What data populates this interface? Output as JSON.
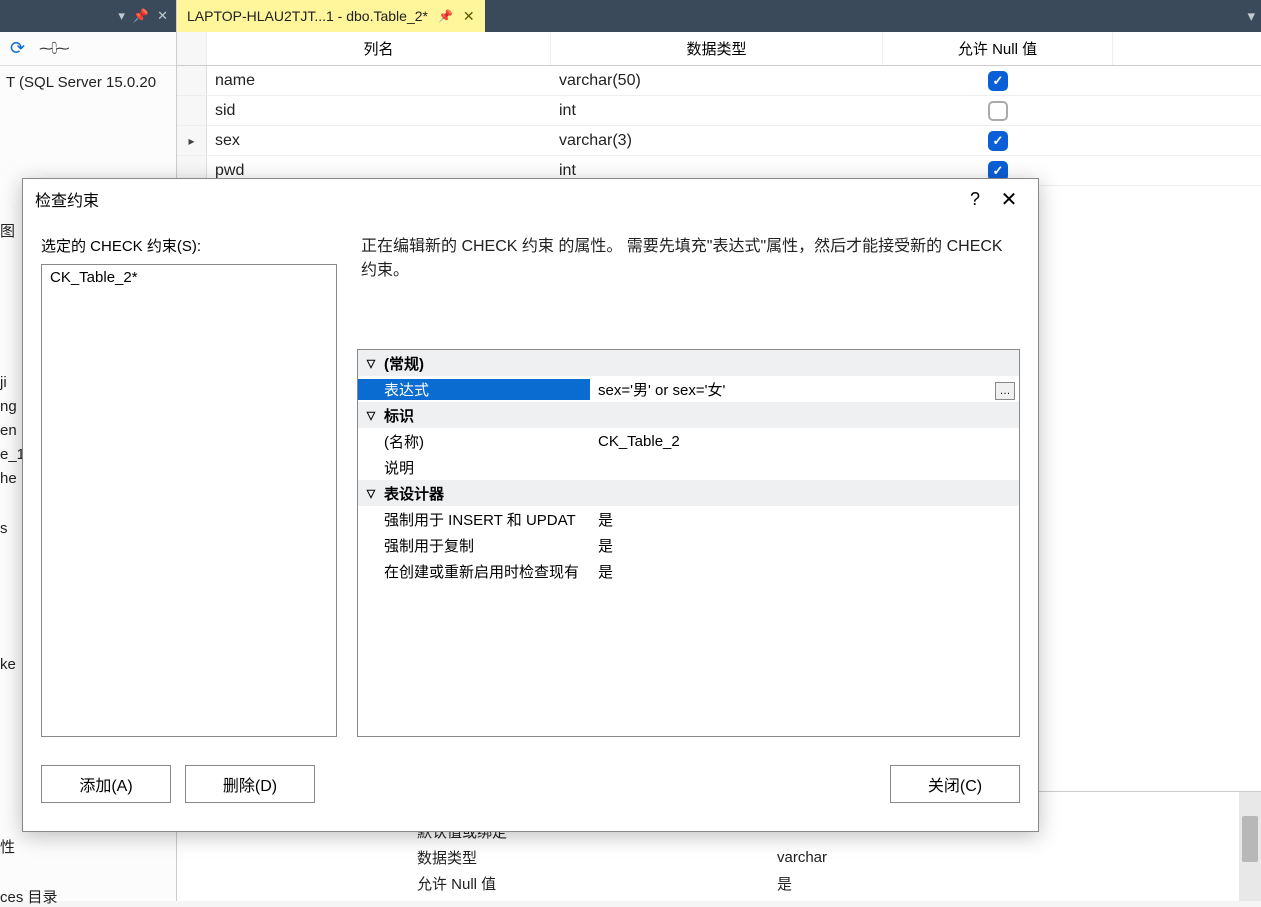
{
  "left_panel": {
    "server_line": "T (SQL Server 15.0.20",
    "fragments": [
      "图",
      "ji",
      "ng",
      "en",
      "e_1",
      "he",
      "s",
      "ces 目录",
      "性"
    ]
  },
  "tab": {
    "title": "LAPTOP-HLAU2TJT...1 - dbo.Table_2*"
  },
  "designer": {
    "headers": {
      "col_name": "列名",
      "data_type": "数据类型",
      "allow_null": "允许 Null 值"
    },
    "rows": [
      {
        "name": "name",
        "type": "varchar(50)",
        "allow_null": true,
        "active": false
      },
      {
        "name": "sid",
        "type": "int",
        "allow_null": false,
        "active": false
      },
      {
        "name": "sex",
        "type": "varchar(3)",
        "allow_null": true,
        "active": true
      },
      {
        "name": "pwd",
        "type": "int",
        "allow_null": true,
        "active": false
      }
    ]
  },
  "dialog": {
    "title": "检查约束",
    "list_label": "选定的 CHECK 约束(S):",
    "list_items": [
      "CK_Table_2*"
    ],
    "description": "正在编辑新的 CHECK 约束 的属性。  需要先填充\"表达式\"属性，然后才能接受新的 CHECK 约束。",
    "groups": {
      "general": "(常规)",
      "identity": "标识",
      "designer": "表设计器"
    },
    "props": {
      "expression_label": "表达式",
      "expression_value": "sex='男' or sex='女'",
      "name_label": "(名称)",
      "name_value": "CK_Table_2",
      "desc_label": "说明",
      "desc_value": "",
      "enforce_insert_label": "强制用于 INSERT 和 UPDAT",
      "enforce_insert_value": "是",
      "enforce_repl_label": "强制用于复制",
      "enforce_repl_value": "是",
      "check_existing_label": "在创建或重新启用时检查现有",
      "check_existing_value": "是"
    },
    "buttons": {
      "add": "添加(A)",
      "delete": "删除(D)",
      "close": "关闭(C)"
    }
  },
  "bottom_props": {
    "rows": [
      {
        "label": "默认值或绑定",
        "value": ""
      },
      {
        "label": "数据类型",
        "value": "varchar"
      },
      {
        "label": "允许 Null 值",
        "value": "是"
      }
    ]
  }
}
